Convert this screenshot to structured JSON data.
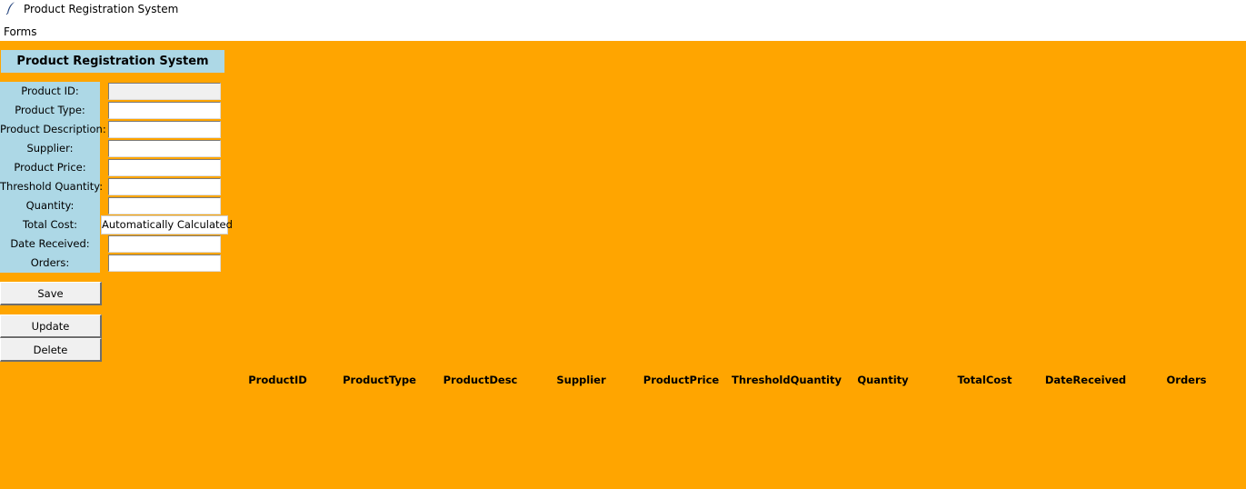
{
  "window": {
    "title": "Product Registration System",
    "icon": "feather-icon"
  },
  "menu": {
    "items": [
      "Forms"
    ]
  },
  "form": {
    "title": "Product Registration System",
    "fields": [
      {
        "label": "Product ID:",
        "value": "",
        "readonly": true
      },
      {
        "label": "Product Type:",
        "value": ""
      },
      {
        "label": "Product Description:",
        "value": ""
      },
      {
        "label": "Supplier:",
        "value": ""
      },
      {
        "label": "Product Price:",
        "value": ""
      },
      {
        "label": "Threshold Quantity:",
        "value": ""
      },
      {
        "label": "Quantity:",
        "value": ""
      },
      {
        "label": "Total Cost:",
        "value": "Automatically Calculated"
      },
      {
        "label": "Date Received:",
        "value": ""
      },
      {
        "label": "Orders:",
        "value": ""
      }
    ]
  },
  "buttons": {
    "save": "Save",
    "update": "Update",
    "delete": "Delete"
  },
  "table": {
    "columns": [
      "ProductID",
      "ProductType",
      "ProductDesc",
      "Supplier",
      "ProductPrice",
      "ThresholdQuantity",
      "Quantity",
      "TotalCost",
      "DateReceived",
      "Orders"
    ],
    "rows": []
  },
  "colors": {
    "background": "#ffa500",
    "form_panel": "#add8e6"
  }
}
